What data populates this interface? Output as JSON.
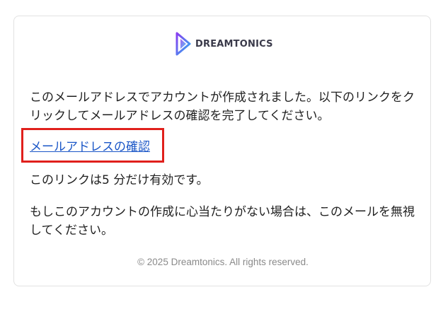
{
  "brand": {
    "name": "DREAMTONICS",
    "colors": {
      "gradient_start": "#8a3cf0",
      "gradient_end": "#2fb0f0"
    },
    "icon": "dreamtonics-logo-icon"
  },
  "email": {
    "intro": "このメールアドレスでアカウントが作成されました。以下のリンクをクリックしてメールアドレスの確認を完了してください。",
    "confirm_link": "メールアドレスの確認",
    "validity": "このリンクは5 分だけ有効です。",
    "disclaimer": "もしこのアカウントの作成に心当たりがない場合は、このメールを無視してください。"
  },
  "footer": {
    "copyright": "© 2025 Dreamtonics. All rights reserved."
  },
  "colors": {
    "link": "#1a56c7",
    "highlight_border": "#e0201c",
    "text": "#1f1f1f",
    "footer_text": "#8a8a8a"
  }
}
